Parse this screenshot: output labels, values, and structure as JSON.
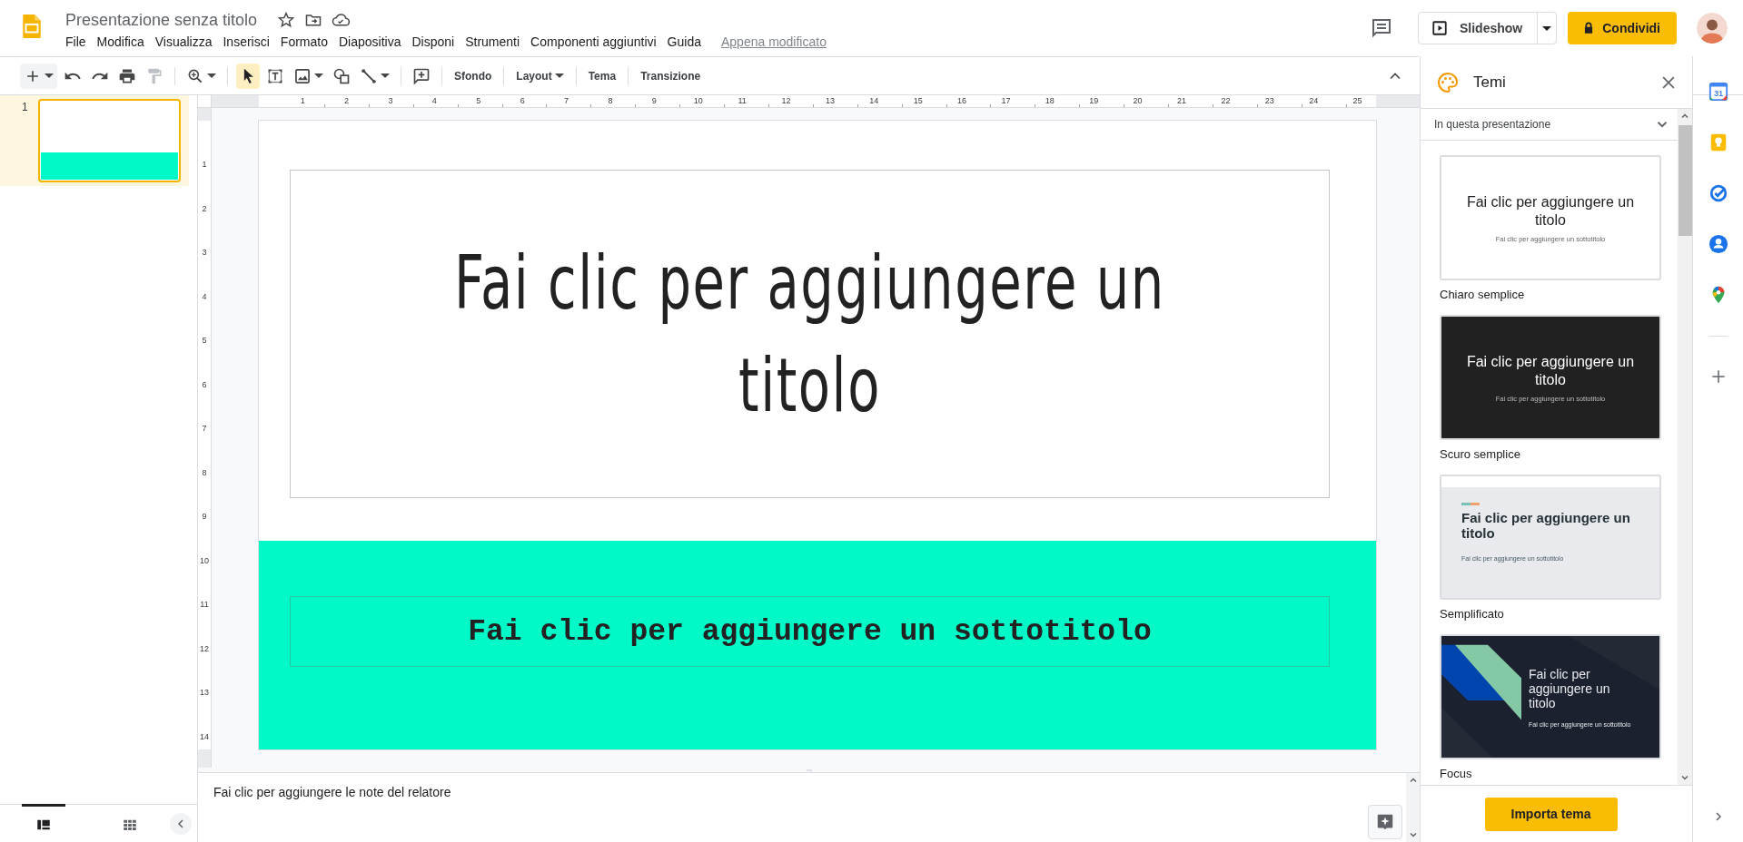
{
  "app": {
    "title": "Presentazione senza titolo",
    "menu": [
      "File",
      "Modifica",
      "Visualizza",
      "Inserisci",
      "Formato",
      "Diapositiva",
      "Disponi",
      "Strumenti",
      "Componenti aggiuntivi",
      "Guida"
    ],
    "save_status": "Appena modificato"
  },
  "header": {
    "slideshow": "Slideshow",
    "share": "Condividi"
  },
  "toolbar": {
    "tools": [
      {
        "kind": "add",
        "dropdown": true,
        "selected": false
      },
      {
        "kind": "undo",
        "dropdown": false,
        "selected": false
      },
      {
        "kind": "redo",
        "dropdown": false,
        "selected": false
      },
      {
        "kind": "print",
        "dropdown": false,
        "selected": false
      },
      {
        "kind": "paint",
        "dropdown": false,
        "selected": false
      },
      {
        "kind": "sep"
      },
      {
        "kind": "zoom",
        "dropdown": true,
        "selected": false
      },
      {
        "kind": "sep"
      },
      {
        "kind": "pointer",
        "dropdown": false,
        "selected": true
      },
      {
        "kind": "textbox",
        "dropdown": false,
        "selected": false
      },
      {
        "kind": "image",
        "dropdown": true,
        "selected": false
      },
      {
        "kind": "shape",
        "dropdown": false,
        "selected": false
      },
      {
        "kind": "line",
        "dropdown": true,
        "selected": false
      },
      {
        "kind": "sep"
      },
      {
        "kind": "comment",
        "dropdown": false,
        "selected": false
      },
      {
        "kind": "sep"
      }
    ],
    "text_buttons": [
      {
        "label": "Sfondo",
        "dropdown": false
      },
      {
        "label": "Layout",
        "dropdown": true
      },
      {
        "label": "Tema",
        "dropdown": false
      },
      {
        "label": "Transizione",
        "dropdown": false
      }
    ]
  },
  "ruler": {
    "horizontal": [
      "1",
      "2",
      "3",
      "4",
      "5",
      "6",
      "7",
      "8",
      "9",
      "10",
      "11",
      "12",
      "13",
      "14",
      "15",
      "16",
      "17",
      "18",
      "19",
      "20",
      "21",
      "22",
      "23",
      "24",
      "25"
    ],
    "vertical": [
      "1",
      "2",
      "3",
      "4",
      "5",
      "6",
      "7",
      "8",
      "9",
      "10",
      "11",
      "12",
      "13",
      "14"
    ]
  },
  "filmstrip": {
    "slides": [
      {
        "number": "1",
        "selected": true
      }
    ],
    "view_tabs": [
      {
        "kind": "list",
        "selected": true
      },
      {
        "kind": "grid",
        "selected": false
      }
    ]
  },
  "slide": {
    "title": "Fai clic per aggiungere un titolo",
    "subtitle": "Fai clic per aggiungere un sottotitolo"
  },
  "notes": {
    "placeholder": "Fai clic per aggiungere le note del relatore"
  },
  "themes_panel": {
    "title": "Temi",
    "filter": "In questa presentazione",
    "themes": [
      {
        "name": "Chiaro semplice",
        "kind": "light",
        "preview_title": "Fai clic per aggiungere un titolo",
        "preview_subtitle": "Fai clic per aggiungere un sottotitolo"
      },
      {
        "name": "Scuro semplice",
        "kind": "dark",
        "preview_title": "Fai clic per aggiungere un titolo",
        "preview_subtitle": "Fai clic per aggiungere un sottotitolo"
      },
      {
        "name": "Semplificato",
        "kind": "simple",
        "preview_title": "Fai clic per aggiungere un titolo",
        "preview_subtitle": "Fai clic per aggiungere un sottotitolo"
      },
      {
        "name": "Focus",
        "kind": "focus",
        "preview_title": "Fai clic per aggiungere un titolo",
        "preview_subtitle": "Fai clic per aggiungere un sottotitolo"
      }
    ],
    "import_button": "Importa tema"
  },
  "side_apps": [
    {
      "kind": "calendar",
      "label": "31"
    },
    {
      "kind": "keep"
    },
    {
      "kind": "tasks"
    },
    {
      "kind": "contacts"
    },
    {
      "kind": "maps"
    },
    {
      "kind": "divider"
    },
    {
      "kind": "add"
    }
  ]
}
